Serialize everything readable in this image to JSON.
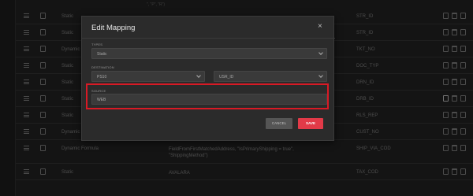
{
  "table_rows": [
    {
      "type": "Static",
      "source": "",
      "destination": "STR_ID"
    },
    {
      "type": "Static",
      "source": "",
      "destination": "STR_ID"
    },
    {
      "type": "Dynamic",
      "source": "",
      "destination": "TKT_NO"
    },
    {
      "type": "Static",
      "source": "",
      "destination": "DOC_TYP"
    },
    {
      "type": "Static",
      "source": "",
      "destination": "DRN_ID"
    },
    {
      "type": "Static",
      "source": "",
      "destination": "DRB_ID"
    },
    {
      "type": "Static",
      "source": "",
      "destination": "RLS_REP"
    },
    {
      "type": "Dynamic Formula",
      "source": "CustomerFromFirstItemAddress",
      "destination": "CUST_NO"
    },
    {
      "type": "Dynamic Formula",
      "source": "FieldFromFirstMatchedAddress, \"IsPrimaryShipping = true\", \"ShippingMethod\")",
      "destination": "SHIP_VIA_COD"
    },
    {
      "type": "Static",
      "source": "AVALARA",
      "destination": "TAX_COD"
    }
  ],
  "top_fragment": "\", \"P\", \"R\")",
  "modal": {
    "title": "Edit Mapping",
    "close_glyph": "×",
    "types_label": "TYPES",
    "types_value": "Static",
    "destination_label": "DESTINATION",
    "destination_value": "PS10",
    "destination_field_value": "USR_ID",
    "source_label": "SOURCE",
    "source_value": "WEB",
    "cancel_label": "CANCEL",
    "save_label": "SAVE"
  },
  "colors": {
    "accent": "#e23a48",
    "highlight": "#d81a25"
  }
}
